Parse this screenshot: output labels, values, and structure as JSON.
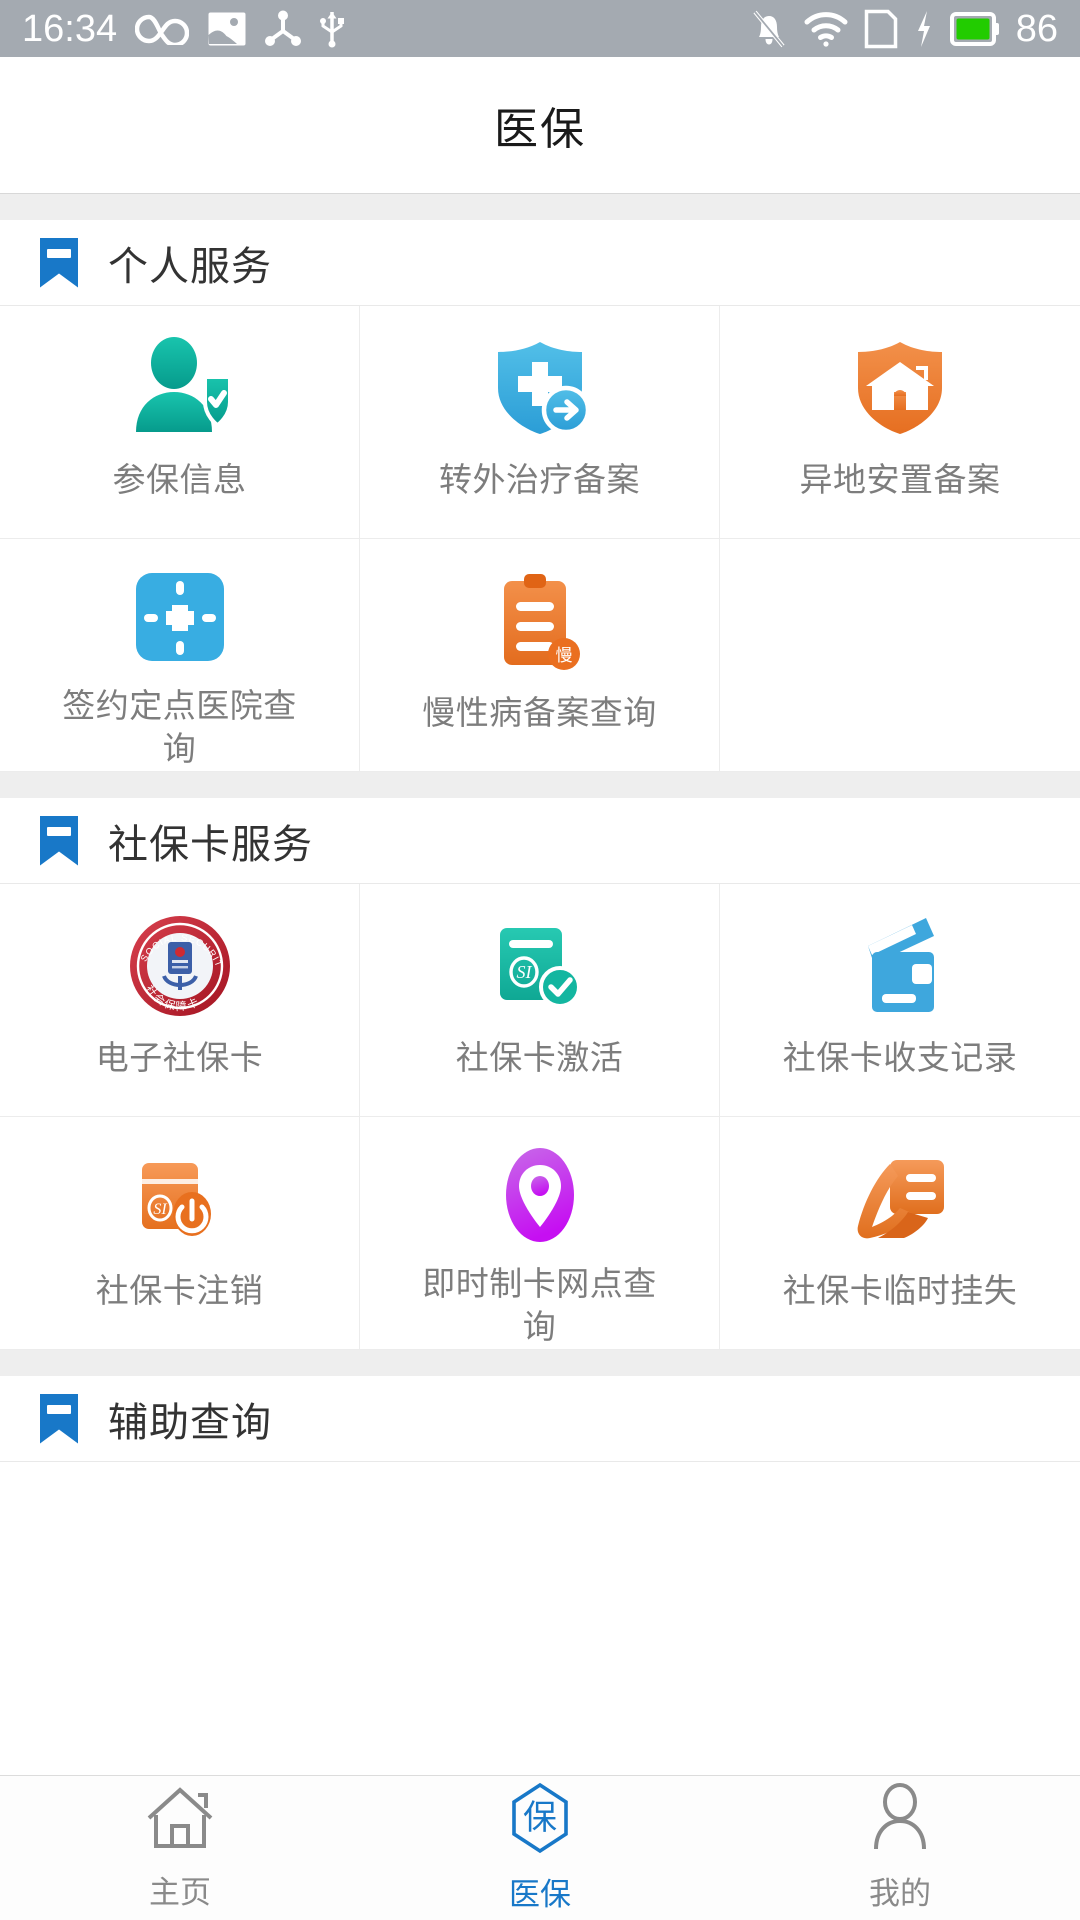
{
  "status_bar": {
    "time": "16:34",
    "battery_percent": "86",
    "left_icons": [
      "infinity-icon",
      "image-icon",
      "bluetooth-share-icon",
      "usb-icon"
    ],
    "right_icons": [
      "mute-bell-icon",
      "wifi-icon",
      "sim-card-icon",
      "charging-bolt-icon",
      "battery-icon"
    ],
    "background_color": "#a4aab1",
    "battery_fill_color": "#22cc00"
  },
  "header": {
    "title": "医保"
  },
  "accent_color": "#1878c8",
  "sections": [
    {
      "title": "个人服务",
      "icon": "ribbon-bookmark-icon",
      "items": [
        {
          "label": "参保信息",
          "icon": "person-shield-check-icon",
          "color": "#12b0a0"
        },
        {
          "label": "转外治疗备案",
          "icon": "shield-cross-arrow-icon",
          "color": "#3daee4"
        },
        {
          "label": "异地安置备案",
          "icon": "shield-house-icon",
          "color": "#ee7e32"
        },
        {
          "label": "签约定点医院查询",
          "icon": "cross-square-icon",
          "color": "#38ade2"
        },
        {
          "label": "慢性病备案查询",
          "icon": "clipboard-chronic-icon",
          "color": "#ee7528"
        },
        {
          "label": "",
          "icon": "",
          "color": ""
        }
      ]
    },
    {
      "title": "社保卡服务",
      "icon": "ribbon-bookmark-icon",
      "items": [
        {
          "label": "电子社保卡",
          "icon": "social-security-card-emblem-icon",
          "color": "#bf2333"
        },
        {
          "label": "社保卡激活",
          "icon": "card-si-check-icon",
          "color": "#18bfa8"
        },
        {
          "label": "社保卡收支记录",
          "icon": "card-stack-icon",
          "color": "#3ea7dd"
        },
        {
          "label": "社保卡注销",
          "icon": "card-power-off-icon",
          "color": "#f0803a"
        },
        {
          "label": "即时制卡网点查询",
          "icon": "map-pin-icon",
          "color": "#c422f0"
        },
        {
          "label": "社保卡临时挂失",
          "icon": "hand-card-icon",
          "color": "#ec7a33"
        }
      ]
    },
    {
      "title": "辅助查询",
      "icon": "ribbon-bookmark-icon",
      "items": []
    }
  ],
  "tabbar": {
    "tabs": [
      {
        "label": "主页",
        "icon": "home-icon",
        "active": false
      },
      {
        "label": "医保",
        "icon": "bao-hexagon-icon",
        "active": true
      },
      {
        "label": "我的",
        "icon": "person-icon",
        "active": false
      }
    ],
    "active_color": "#1878c8",
    "inactive_color": "#8a8a8a"
  }
}
